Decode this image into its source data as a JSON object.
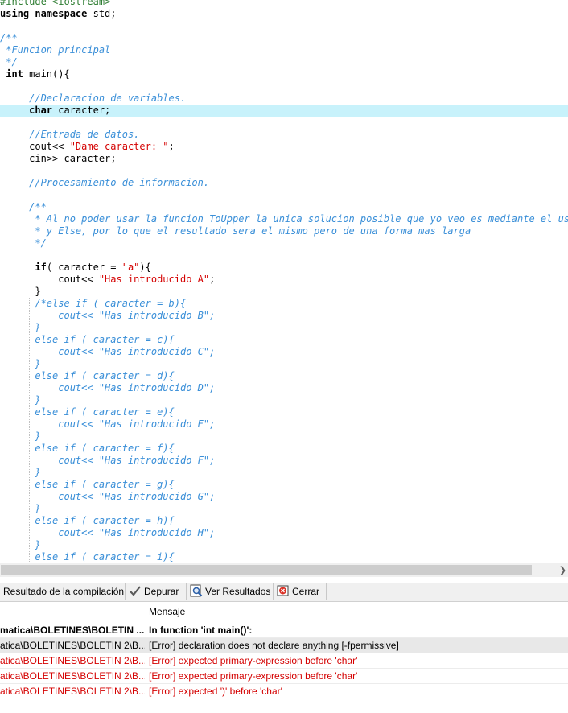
{
  "code": [
    {
      "segments": [
        {
          "t": "#include <iostream>",
          "c": "pp"
        }
      ]
    },
    {
      "segments": [
        {
          "t": "using namespace ",
          "c": "kw"
        },
        {
          "t": "std;",
          "c": ""
        }
      ]
    },
    {
      "segments": []
    },
    {
      "segments": [
        {
          "t": "/**",
          "c": "cm"
        }
      ]
    },
    {
      "segments": [
        {
          "t": " *Funcion principal",
          "c": "cm"
        }
      ]
    },
    {
      "segments": [
        {
          "t": " */",
          "c": "cm"
        }
      ]
    },
    {
      "segments": [
        {
          "t": " int ",
          "c": "kw"
        },
        {
          "t": "main(){",
          "c": ""
        }
      ]
    },
    {
      "segments": []
    },
    {
      "segments": [
        {
          "t": "     //Declaracion de variables.",
          "c": "cm"
        }
      ]
    },
    {
      "segments": [
        {
          "t": "     ",
          "c": ""
        },
        {
          "t": "char ",
          "c": "kw"
        },
        {
          "t": "caracter;",
          "c": ""
        }
      ],
      "highlight": true
    },
    {
      "segments": []
    },
    {
      "segments": [
        {
          "t": "     //Entrada de datos.",
          "c": "cm"
        }
      ]
    },
    {
      "segments": [
        {
          "t": "     cout<< ",
          "c": ""
        },
        {
          "t": "\"Dame caracter: \"",
          "c": "str"
        },
        {
          "t": ";",
          "c": ""
        }
      ]
    },
    {
      "segments": [
        {
          "t": "     cin>> caracter;",
          "c": ""
        }
      ]
    },
    {
      "segments": []
    },
    {
      "segments": [
        {
          "t": "     //Procesamiento de informacion.",
          "c": "cm"
        }
      ]
    },
    {
      "segments": []
    },
    {
      "segments": [
        {
          "t": "     /**",
          "c": "cm"
        }
      ]
    },
    {
      "segments": [
        {
          "t": "      * Al no poder usar la funcion ToUpper la unica solucion posible que yo veo es mediante el use a",
          "c": "cm"
        }
      ]
    },
    {
      "segments": [
        {
          "t": "      * y Else, por lo que el resultado sera el mismo pero de una forma mas larga",
          "c": "cm"
        }
      ]
    },
    {
      "segments": [
        {
          "t": "      */",
          "c": "cm"
        }
      ]
    },
    {
      "segments": []
    },
    {
      "segments": [
        {
          "t": "      ",
          "c": ""
        },
        {
          "t": "if",
          "c": "kw"
        },
        {
          "t": "( caracter = ",
          "c": ""
        },
        {
          "t": "\"a\"",
          "c": "str"
        },
        {
          "t": "){",
          "c": ""
        }
      ]
    },
    {
      "segments": [
        {
          "t": "          cout<< ",
          "c": ""
        },
        {
          "t": "\"Has introducido A\"",
          "c": "str"
        },
        {
          "t": ";",
          "c": ""
        }
      ]
    },
    {
      "segments": [
        {
          "t": "      }",
          "c": ""
        }
      ]
    },
    {
      "segments": [
        {
          "t": "      /*else if ( caracter = b){",
          "c": "cm"
        }
      ]
    },
    {
      "segments": [
        {
          "t": "          cout<< \"Has introducido B\";",
          "c": "cm"
        }
      ]
    },
    {
      "segments": [
        {
          "t": "      }",
          "c": "cm"
        }
      ]
    },
    {
      "segments": [
        {
          "t": "      else if ( caracter = c){",
          "c": "cm"
        }
      ]
    },
    {
      "segments": [
        {
          "t": "          cout<< \"Has introducido C\";",
          "c": "cm"
        }
      ]
    },
    {
      "segments": [
        {
          "t": "      }",
          "c": "cm"
        }
      ]
    },
    {
      "segments": [
        {
          "t": "      else if ( caracter = d){",
          "c": "cm"
        }
      ]
    },
    {
      "segments": [
        {
          "t": "          cout<< \"Has introducido D\";",
          "c": "cm"
        }
      ]
    },
    {
      "segments": [
        {
          "t": "      }",
          "c": "cm"
        }
      ]
    },
    {
      "segments": [
        {
          "t": "      else if ( caracter = e){",
          "c": "cm"
        }
      ]
    },
    {
      "segments": [
        {
          "t": "          cout<< \"Has introducido E\";",
          "c": "cm"
        }
      ]
    },
    {
      "segments": [
        {
          "t": "      }",
          "c": "cm"
        }
      ]
    },
    {
      "segments": [
        {
          "t": "      else if ( caracter = f){",
          "c": "cm"
        }
      ]
    },
    {
      "segments": [
        {
          "t": "          cout<< \"Has introducido F\";",
          "c": "cm"
        }
      ]
    },
    {
      "segments": [
        {
          "t": "      }",
          "c": "cm"
        }
      ]
    },
    {
      "segments": [
        {
          "t": "      else if ( caracter = g){",
          "c": "cm"
        }
      ]
    },
    {
      "segments": [
        {
          "t": "          cout<< \"Has introducido G\";",
          "c": "cm"
        }
      ]
    },
    {
      "segments": [
        {
          "t": "      }",
          "c": "cm"
        }
      ]
    },
    {
      "segments": [
        {
          "t": "      else if ( caracter = h){",
          "c": "cm"
        }
      ]
    },
    {
      "segments": [
        {
          "t": "          cout<< \"Has introducido H\";",
          "c": "cm"
        }
      ]
    },
    {
      "segments": [
        {
          "t": "      }",
          "c": "cm"
        }
      ]
    },
    {
      "segments": [
        {
          "t": "      else if ( caracter = i){",
          "c": "cm"
        }
      ]
    }
  ],
  "tabs": {
    "compile_results": "Resultado de la compilación",
    "debug": "Depurar",
    "view_results": "Ver Resultados",
    "close": "Cerrar"
  },
  "messages": {
    "column_message": "Mensaje",
    "rows": [
      {
        "file": "matica\\BOLETINES\\BOLETIN ...",
        "msg": "In function 'int main()':",
        "kind": "header"
      },
      {
        "file": "atica\\BOLETINES\\BOLETIN 2\\B...",
        "msg": "[Error] declaration does not declare anything [-fpermissive]",
        "kind": "plain",
        "selected": true
      },
      {
        "file": "atica\\BOLETINES\\BOLETIN 2\\B...",
        "msg": "[Error] expected primary-expression before 'char'",
        "kind": "err"
      },
      {
        "file": "atica\\BOLETINES\\BOLETIN 2\\B...",
        "msg": "[Error] expected primary-expression before 'char'",
        "kind": "err"
      },
      {
        "file": "atica\\BOLETINES\\BOLETIN 2\\B...",
        "msg": "[Error] expected ')' before 'char'",
        "kind": "err"
      }
    ]
  },
  "colors": {
    "comment": "#3a8fd8",
    "string": "#d40000",
    "highlight_line": "#c8f2fb",
    "error_text": "#d40000"
  },
  "icons": [
    "check-debug-icon",
    "magnifier-results-icon",
    "close-red-icon",
    "scroll-right-arrow-icon"
  ]
}
